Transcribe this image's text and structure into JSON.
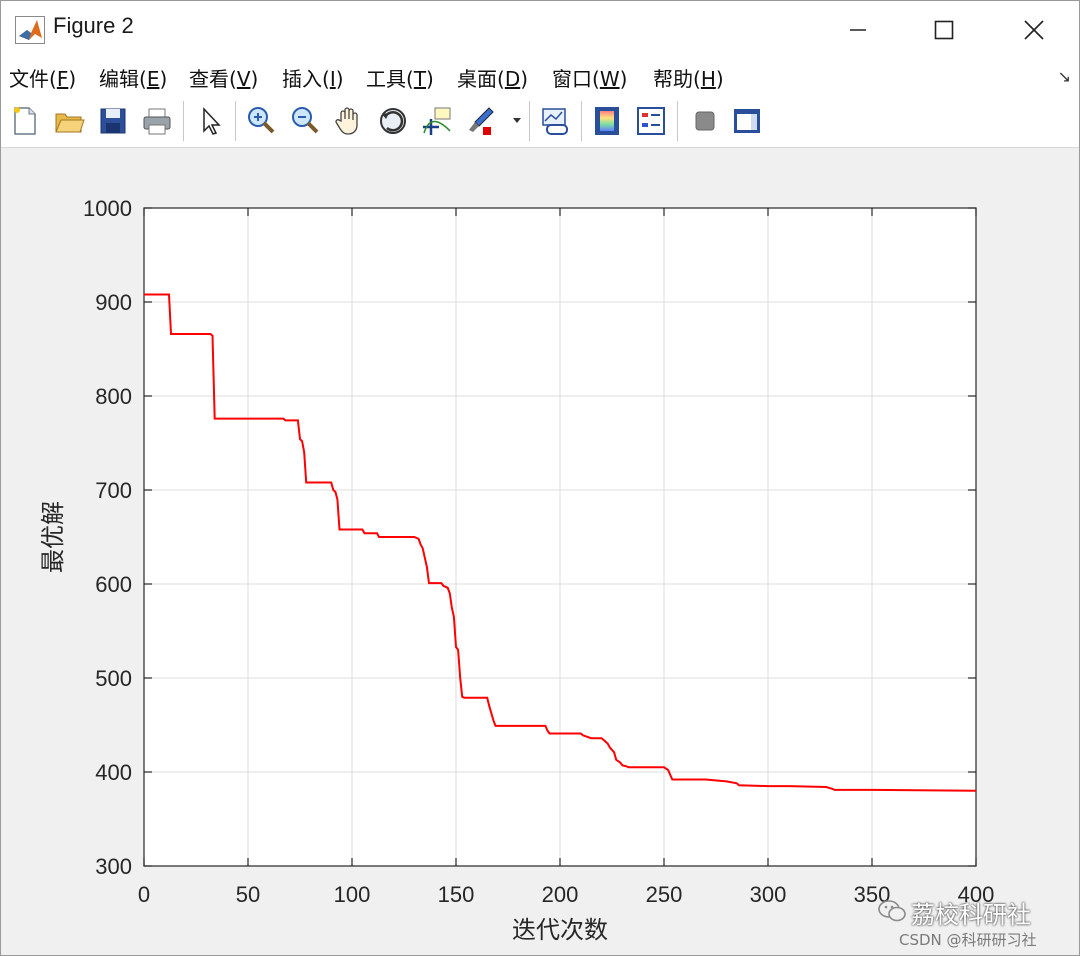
{
  "window": {
    "title": "Figure 2"
  },
  "menu": [
    {
      "label": "文件(",
      "key": "F",
      "end": ")"
    },
    {
      "label": "编辑(",
      "key": "E",
      "end": ")"
    },
    {
      "label": "查看(",
      "key": "V",
      "end": ")"
    },
    {
      "label": "插入(",
      "key": "I",
      "end": ")"
    },
    {
      "label": "工具(",
      "key": "T",
      "end": ")"
    },
    {
      "label": "桌面(",
      "key": "D",
      "end": ")"
    },
    {
      "label": "窗口(",
      "key": "W",
      "end": ")"
    },
    {
      "label": "帮助(",
      "key": "H",
      "end": ")"
    }
  ],
  "toolbar_icons": [
    "new-figure-icon",
    "open-file-icon",
    "save-icon",
    "print-icon",
    "pointer-icon",
    "zoom-in-icon",
    "zoom-out-icon",
    "pan-icon",
    "rotate-3d-icon",
    "data-cursor-icon",
    "brush-icon",
    "link-plot-icon",
    "colorbar-icon",
    "legend-icon",
    "hide-plot-tools-icon",
    "show-plot-tools-icon"
  ],
  "watermark": {
    "main": "荔校科研社",
    "sub": "CSDN @科研研习社"
  },
  "chart_data": {
    "type": "line",
    "xlabel": "迭代次数",
    "ylabel": "最优解",
    "xlim": [
      0,
      400
    ],
    "ylim": [
      300,
      1000
    ],
    "xticks": [
      0,
      50,
      100,
      150,
      200,
      250,
      300,
      350,
      400
    ],
    "yticks": [
      300,
      400,
      500,
      600,
      700,
      800,
      900,
      1000
    ],
    "grid": true,
    "series": [
      {
        "color": "#ff0000",
        "x": [
          0,
          12,
          13,
          32,
          33,
          33,
          34,
          67,
          68,
          74,
          75,
          76,
          77,
          78,
          90,
          91,
          92,
          93,
          94,
          105,
          106,
          112,
          113,
          130,
          132,
          133,
          134,
          136,
          137,
          143,
          144,
          146,
          147,
          148,
          149,
          150,
          151,
          152,
          153,
          154,
          155,
          165,
          166,
          168,
          169,
          193,
          194,
          195,
          210,
          211,
          215,
          220,
          221,
          223,
          224,
          226,
          227,
          229,
          230,
          232,
          233,
          236,
          250,
          252,
          253,
          254,
          270,
          280,
          285,
          286,
          300,
          310,
          328,
          331,
          332,
          350,
          400
        ],
        "y": [
          908,
          908,
          866,
          866,
          864,
          860,
          776,
          776,
          774,
          774,
          754,
          752,
          740,
          708,
          708,
          700,
          698,
          690,
          658,
          658,
          654,
          654,
          650,
          650,
          648,
          642,
          638,
          618,
          601,
          601,
          598,
          596,
          590,
          575,
          565,
          533,
          530,
          500,
          480,
          479,
          479,
          479,
          470,
          455,
          449,
          449,
          444,
          441,
          441,
          439,
          436,
          436,
          434,
          430,
          426,
          421,
          413,
          410,
          407,
          406,
          405,
          405,
          405,
          402,
          397,
          392,
          392,
          390,
          388,
          386,
          385,
          385,
          384,
          382,
          381,
          381,
          380
        ]
      }
    ]
  }
}
